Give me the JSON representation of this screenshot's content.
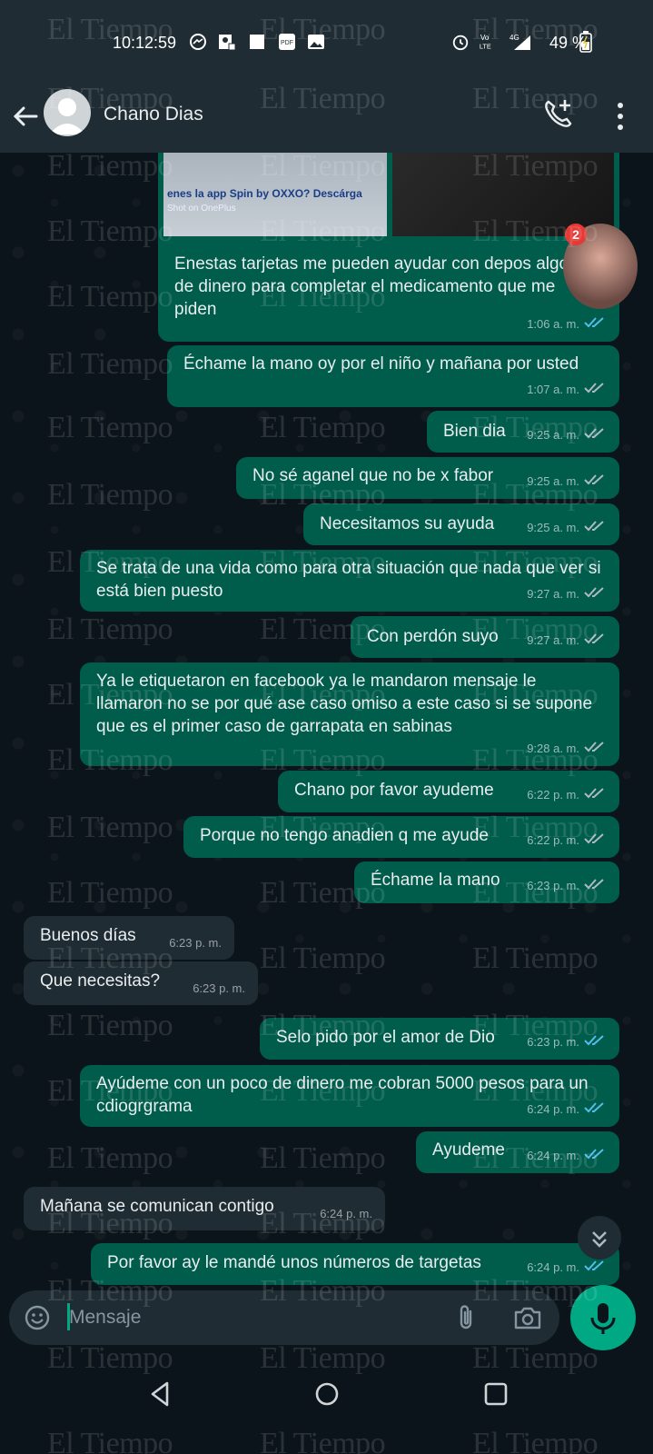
{
  "status_bar": {
    "time": "10:12:59",
    "battery_text": "49 %",
    "icons": [
      "messenger-icon",
      "contact-card-icon",
      "square-icon",
      "pdf-icon",
      "image-icon",
      "alarm-icon",
      "volte-icon",
      "signal-4g-icon",
      "battery-icon"
    ]
  },
  "header": {
    "contact_name": "Chano Dias"
  },
  "image_message": {
    "left_image_text": "enes la app Spin by OXXO? Descárga",
    "left_image_subtext": "Shot on OnePlus",
    "badge_count": "2"
  },
  "messages": [
    {
      "dir": "out",
      "text": "Enestas tarjetas me pueden ayudar con depos algo de dinero para completar el medicamento que me piden",
      "time": "1:06 a. m.",
      "read": true
    },
    {
      "dir": "out",
      "text": "Échame la mano oy por el niño y mañana por usted",
      "time": "1:07 a. m.",
      "read": false
    },
    {
      "dir": "out",
      "text": "Bien dia",
      "time": "9:25 a. m.",
      "read": false
    },
    {
      "dir": "out",
      "text": "No sé aganel que no be x fabor",
      "time": "9:25 a. m.",
      "read": false
    },
    {
      "dir": "out",
      "text": "Necesitamos su ayuda",
      "time": "9:25 a. m.",
      "read": false
    },
    {
      "dir": "out",
      "text": "Se trata de una vida como para otra situación que nada que ver si está bien puesto",
      "time": "9:27 a. m.",
      "read": false
    },
    {
      "dir": "out",
      "text": "Con perdón suyo",
      "time": "9:27 a. m.",
      "read": false
    },
    {
      "dir": "out",
      "text": "Ya le etiquetaron en facebook ya le mandaron mensaje le llamaron no se por qué ase caso omiso a este caso si se supone que es el primer caso de garrapata en sabinas",
      "time": "9:28 a. m.",
      "read": false
    },
    {
      "dir": "out",
      "text": "Chano por favor ayudeme",
      "time": "6:22 p. m.",
      "read": false
    },
    {
      "dir": "out",
      "text": "Porque no tengo anadien q me ayude",
      "time": "6:22 p. m.",
      "read": false
    },
    {
      "dir": "out",
      "text": "Échame la mano",
      "time": "6:23 p. m.",
      "read": false
    },
    {
      "dir": "in",
      "text": "Buenos días",
      "time": "6:23 p. m."
    },
    {
      "dir": "in",
      "text": "Que necesitas?",
      "time": "6:23 p. m."
    },
    {
      "dir": "out",
      "text": "Selo pido por el amor de Dio",
      "time": "6:23 p. m.",
      "read": true
    },
    {
      "dir": "out",
      "text": "Ayúdeme con un poco de dinero me cobran 5000 pesos para un cdiogrgrama",
      "time": "6:24 p. m.",
      "read": true
    },
    {
      "dir": "out",
      "text": "Ayudeme",
      "time": "6:24 p. m.",
      "read": true
    },
    {
      "dir": "in",
      "text": "Mañana se comunican contigo",
      "time": "6:24 p. m."
    },
    {
      "dir": "out",
      "text": "Por favor ay le mandé unos números de targetas",
      "time": "6:24 p. m.",
      "read": true
    }
  ],
  "input": {
    "placeholder": "Mensaje"
  },
  "watermark": "El Tiempo",
  "colors": {
    "outgoing_bubble": "#005c4b",
    "incoming_bubble": "#202c33",
    "accent": "#00a884",
    "read_tick": "#53bdeb",
    "background": "#0b141a"
  }
}
